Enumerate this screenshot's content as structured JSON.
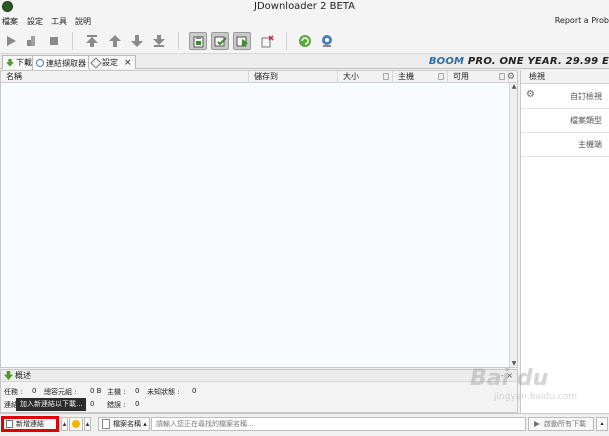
{
  "window": {
    "title": "JDownloader 2 BETA",
    "icon": "jdownloader-logo-icon"
  },
  "menu": {
    "items": [
      "檔案",
      "設定",
      "工具",
      "說明"
    ],
    "report": "Report a Prob"
  },
  "toolbar": {
    "buttons": [
      {
        "icon": "play-icon"
      },
      {
        "icon": "pause-icon"
      },
      {
        "icon": "stop-icon"
      },
      {
        "icon": "move-top-icon"
      },
      {
        "icon": "move-up-icon"
      },
      {
        "icon": "move-down-icon"
      },
      {
        "icon": "move-bottom-icon"
      },
      {
        "icon": "clipboard-observer-icon",
        "pressed": true
      },
      {
        "icon": "auto-confirm-icon",
        "pressed": true
      },
      {
        "icon": "auto-start-icon",
        "pressed": true
      },
      {
        "icon": "clear-list-icon"
      },
      {
        "icon": "reconnect-icon"
      },
      {
        "icon": "update-icon"
      }
    ]
  },
  "tabs": [
    {
      "label": "下載",
      "icon": "download-tab-icon"
    },
    {
      "label": "連結擷取器",
      "icon": "linkgrabber-tab-icon",
      "active": true
    },
    {
      "label": "設定",
      "icon": "settings-tab-icon",
      "closable": true,
      "close": "×"
    }
  ],
  "promo": {
    "brand": "BOOM",
    "text": "PRO. ONE YEAR. 29.99 E",
    "accent": "#2e6ea6"
  },
  "table": {
    "columns": [
      "名稱",
      "儲存到",
      "大小",
      "主機",
      "可用"
    ],
    "settings_icon": "⚙",
    "rows": []
  },
  "sidepanel": {
    "title": "檢視",
    "items": [
      "自訂檢視",
      "檔案類型",
      "主機端"
    ]
  },
  "overview": {
    "title": "概述",
    "controls": "- ×",
    "row1": {
      "a_label": "任務 :",
      "a_value": "0",
      "b_label": "總容元組 :",
      "b_value": "0 B",
      "c_label": "主機 :",
      "c_value": "0",
      "d_label": "未知狀態 :",
      "d_value": "0"
    },
    "row2": {
      "a_label": "連結",
      "b_value": "0",
      "c_label": "錯誤 :",
      "c_value": "0"
    }
  },
  "bottombar": {
    "add_links": "新增連結",
    "filter": "檔案名稱",
    "search_placeholder": "請輸入您正在尋找的檔案名稱...",
    "start_all": "啟動所有下載",
    "tooltip": "加入新連結以下載..."
  },
  "watermark": {
    "text": "Bai du",
    "sub": "jingyan.baidu.com"
  },
  "colors": {
    "highlight": "#e00000",
    "list_bg": "#f6fcfd",
    "toolbar_bg": "#f4f4f4"
  }
}
